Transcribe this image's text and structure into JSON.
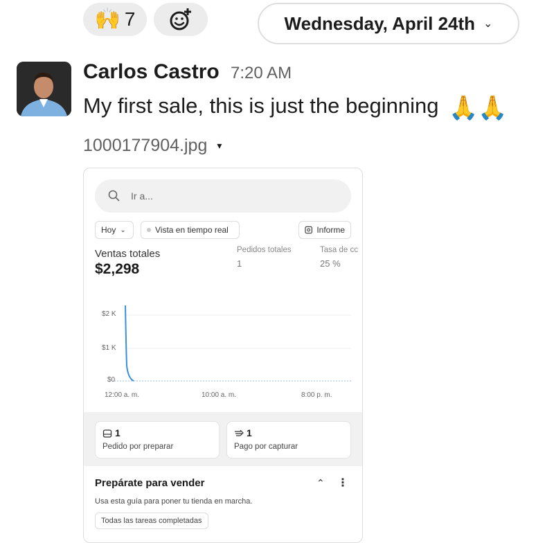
{
  "reactions": [
    {
      "icon": "raising-hands-emoji",
      "glyph": "🙌",
      "count": "7"
    },
    {
      "icon": "add-reaction-icon",
      "glyph": ""
    }
  ],
  "date_divider": {
    "label": "Wednesday, April 24th",
    "chevron": "⌄"
  },
  "message": {
    "author": "Carlos Castro",
    "time": "7:20 AM",
    "text": "My first sale, this is just the beginning",
    "emoji": "🙏🙏",
    "attachment": {
      "filename": "1000177904.jpg",
      "caret": "▾"
    }
  },
  "embedded": {
    "search_placeholder": "Ir a...",
    "filters": {
      "period": "Hoy",
      "period_chevron": "⌄",
      "live": "Vista en tiempo real",
      "report": "Informe"
    },
    "kpis": {
      "sales_label": "Ventas totales",
      "sales_value": "$2,298",
      "orders_label": "Pedidos totales",
      "orders_value": "1",
      "rate_label": "Tasa de cc",
      "rate_value": "25 %"
    },
    "chart_yticks": [
      "$2 K",
      "$1 K",
      "$0"
    ],
    "chart_xticks": [
      "12:00 a. m.",
      "10:00 a. m.",
      "8:00 p. m."
    ],
    "cards": [
      {
        "count": "1",
        "label": "Pedido por preparar",
        "icon": "inbox-icon"
      },
      {
        "count": "1",
        "label": "Pago por capturar",
        "icon": "payment-icon"
      }
    ],
    "guide": {
      "title": "Prepárate para vender",
      "description": "Usa esta guía para poner tu tienda en marcha.",
      "chip": "Todas las tareas completadas",
      "collapse": "⌃",
      "more": "⋮"
    },
    "colors": {
      "line": "#3b8fd9",
      "muted": "#888888"
    }
  }
}
